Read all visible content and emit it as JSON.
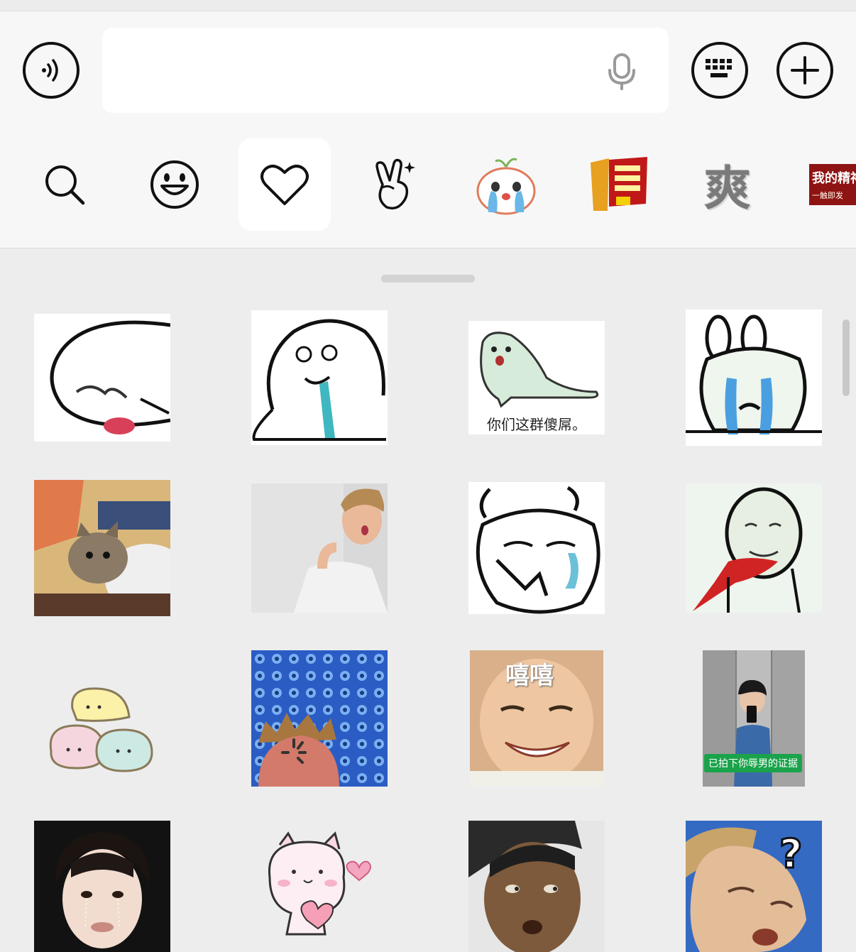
{
  "input": {
    "text": "",
    "placeholder": ""
  },
  "icons": {
    "voice": "voice-icon",
    "mic": "microphone-icon",
    "keyboard": "keyboard-icon",
    "add": "plus-icon"
  },
  "tabs": [
    {
      "name": "search",
      "icon": "search-icon",
      "active": false
    },
    {
      "name": "emoji",
      "icon": "smiley-icon",
      "active": false
    },
    {
      "name": "favorites",
      "icon": "heart-icon",
      "active": true
    },
    {
      "name": "gestures",
      "icon": "victory-hand-icon",
      "active": false
    },
    {
      "name": "sticker-pack-1",
      "icon": "crying-bun-icon",
      "active": false
    },
    {
      "name": "sticker-pack-2",
      "icon": "text-sticker-icon",
      "active": false
    },
    {
      "name": "sticker-pack-3",
      "label": "爽",
      "active": false
    },
    {
      "name": "sticker-pack-4",
      "label": "我的精神",
      "label2": "一触即发",
      "active": false
    }
  ],
  "stickers": {
    "s3_caption": "你们这群傻屌。",
    "s11_caption": "嘻嘻",
    "s12_caption": "已拍下你辱男的证据"
  },
  "colors": {
    "panel": "#ededed",
    "bar": "#f7f7f7",
    "caption_green": "#1aa34a"
  }
}
